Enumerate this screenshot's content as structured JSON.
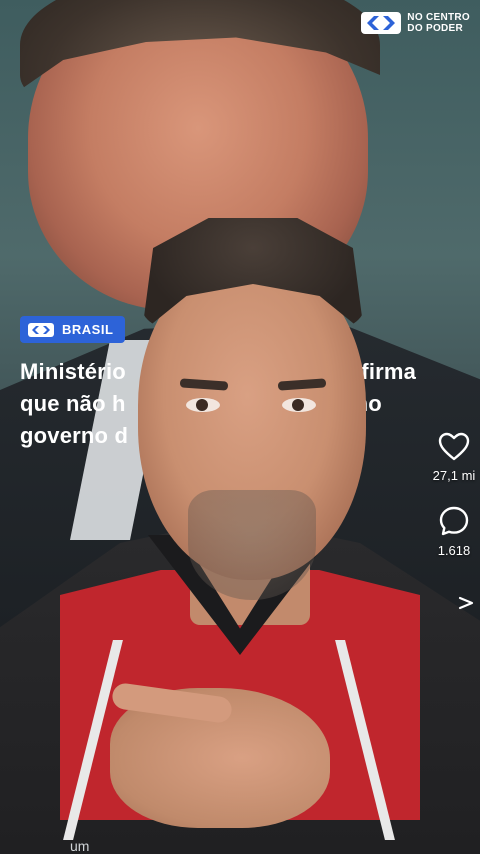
{
  "logo": {
    "line1": "NO CENTRO",
    "line2": "DO PODER"
  },
  "badge": {
    "label": "BRASIL"
  },
  "headline": {
    "line1": "Ministério                               confirma",
    "line2": "que não h                           pção no",
    "line3": "governo d"
  },
  "actions": {
    "like_count": "27,1 mi",
    "comment_count": "1.618"
  },
  "caption": {
    "text": "um"
  },
  "icons": [
    "heart-icon",
    "comment-icon",
    "share-icon",
    "brand-logo-icon"
  ],
  "colors": {
    "badge_bg": "#2d63d8",
    "jersey_red": "#c0262d"
  }
}
